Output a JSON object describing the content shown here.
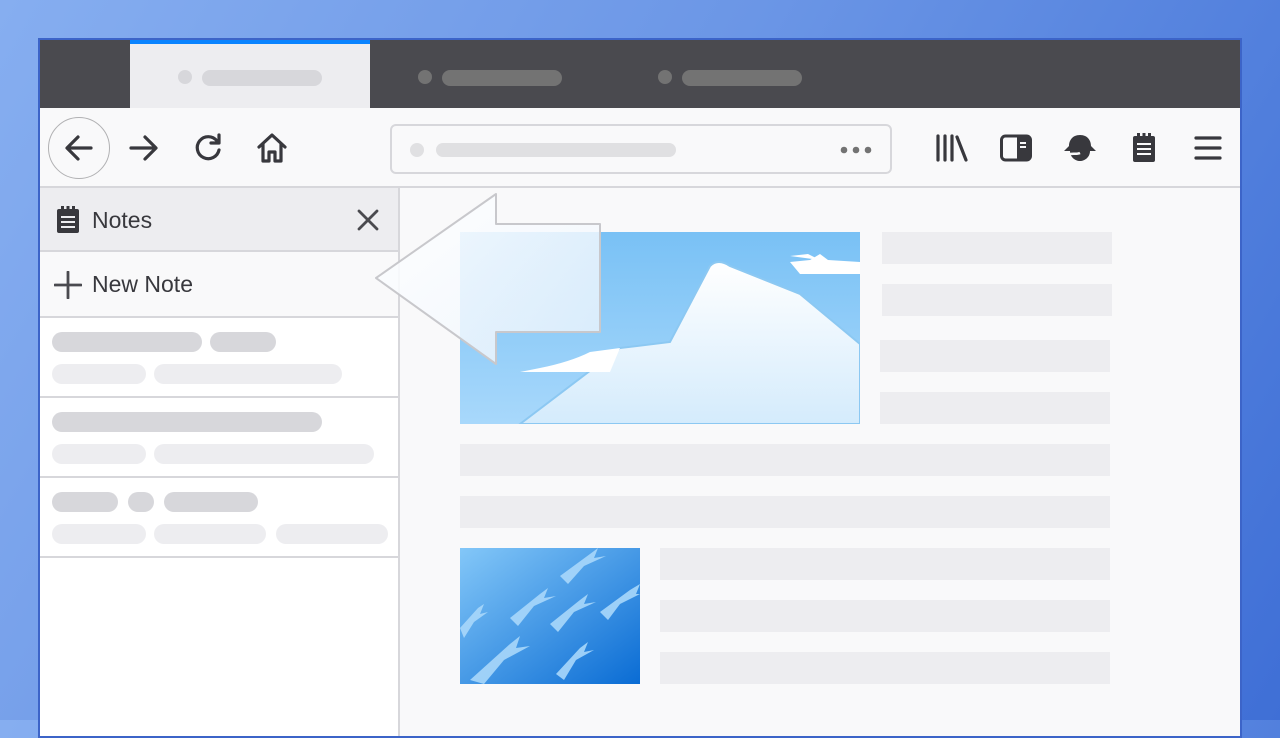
{
  "sidebar": {
    "title": "Notes",
    "new_note_label": "New Note"
  },
  "toolbar": {
    "url_more": "•••"
  },
  "icons": {
    "back": "back-arrow-icon",
    "forward": "forward-arrow-icon",
    "reload": "reload-icon",
    "home": "home-icon",
    "library": "library-icon",
    "sidebar": "sidebar-toggle-icon",
    "account": "account-icon",
    "notes": "notes-icon",
    "menu": "hamburger-menu-icon",
    "close": "close-icon",
    "plus": "plus-icon"
  },
  "colors": {
    "tab_accent": "#0a84ff",
    "tabstrip": "#4a4a4f",
    "icon": "#38383d",
    "border": "#3c64c8"
  }
}
